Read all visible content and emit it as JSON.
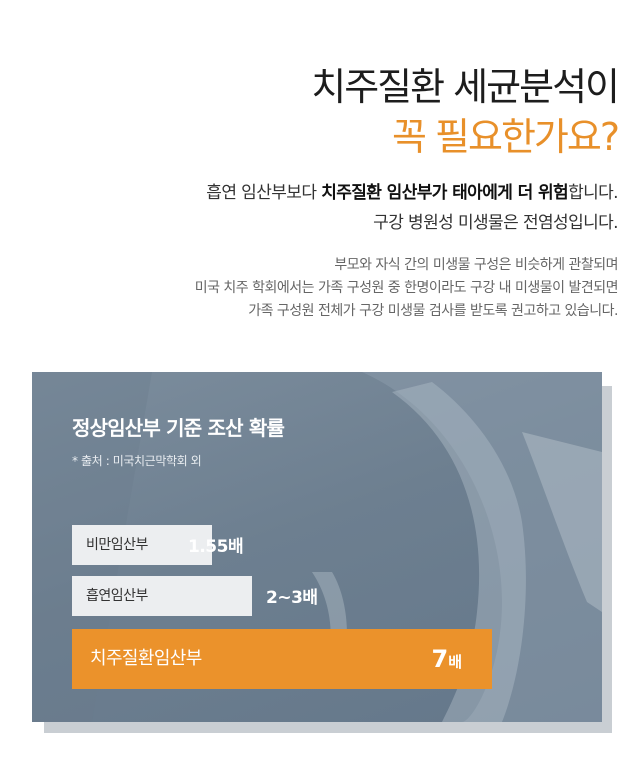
{
  "title": {
    "line1": "치주질환 세균분석이",
    "line2": "꼭 필요한가요?"
  },
  "lead": {
    "line1_pre": "흡연 임산부보다 ",
    "line1_bold": "치주질환 임산부가 태아에게 더 위험",
    "line1_post": "합니다.",
    "line2": "구강 병원성 미생물은 전염성입니다."
  },
  "description": {
    "line1": "부모와 자식 간의 미생물 구성은 비슷하게 관찰되며",
    "line2": "미국 치주 학회에서는 가족 구성원 중 한명이라도 구강 내 미생물이 발견되면",
    "line3": "가족 구성원 전체가 구강 미생물 검사를 받도록 권고하고 있습니다."
  },
  "panel": {
    "title": "정상임산부 기준 조산 확률",
    "source": "* 출처 : 미국치근막학회 외",
    "accent_color": "#eb922b"
  },
  "chart_data": {
    "type": "bar",
    "categories": [
      "비만임산부",
      "흡연임산부",
      "치주질환임산부"
    ],
    "value_labels": [
      "1.55배",
      "2~3배",
      "7배"
    ],
    "values": [
      1.55,
      2.5,
      7
    ],
    "big_value": "7",
    "big_unit": "배"
  }
}
